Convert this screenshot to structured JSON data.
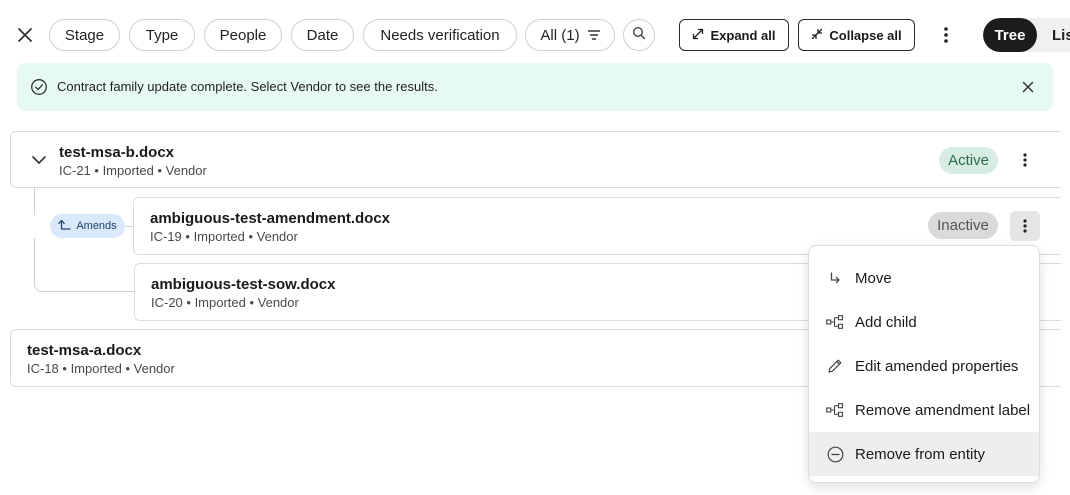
{
  "toolbar": {
    "filters": [
      {
        "label": "Stage"
      },
      {
        "label": "Type"
      },
      {
        "label": "People"
      },
      {
        "label": "Date"
      },
      {
        "label": "Needs verification"
      }
    ],
    "all_filter_label": "All (1)",
    "expand_all_label": "Expand all",
    "collapse_all_label": "Collapse all",
    "view_tree_label": "Tree",
    "view_list_label": "List",
    "active_view": "Tree"
  },
  "banner": {
    "message": "Contract family update complete. Select Vendor to see the results.",
    "color": "#e6faf3",
    "icon": "check-circle-icon"
  },
  "tree": {
    "root": {
      "title": "test-msa-b.docx",
      "meta": "IC-21 • Imported • Vendor",
      "status": "Active",
      "expanded": true,
      "children": [
        {
          "title": "ambiguous-test-amendment.docx",
          "meta": "IC-19 • Imported • Vendor",
          "status": "Inactive",
          "relation_label": "Amends"
        },
        {
          "title": "ambiguous-test-sow.docx",
          "meta": "IC-20 • Imported • Vendor"
        }
      ]
    },
    "others": [
      {
        "title": "test-msa-a.docx",
        "meta": "IC-18 • Imported • Vendor"
      }
    ]
  },
  "context_menu": {
    "items": [
      {
        "label": "Move",
        "icon": "move-arrow-icon"
      },
      {
        "label": "Add child",
        "icon": "hierarchy-icon"
      },
      {
        "label": "Edit amended properties",
        "icon": "pencil-icon"
      },
      {
        "label": "Remove amendment label",
        "icon": "hierarchy-icon"
      },
      {
        "label": "Remove from entity",
        "icon": "minus-circle-icon"
      }
    ],
    "hovered_item": "Remove from entity"
  },
  "colors": {
    "active_status_bg": "#d7ede3",
    "active_status_text": "#2e6b4f",
    "inactive_status_bg": "#dadada",
    "amends_pill_bg": "#d9e8fa",
    "tree_toggle_bg": "#1c1c1c"
  }
}
